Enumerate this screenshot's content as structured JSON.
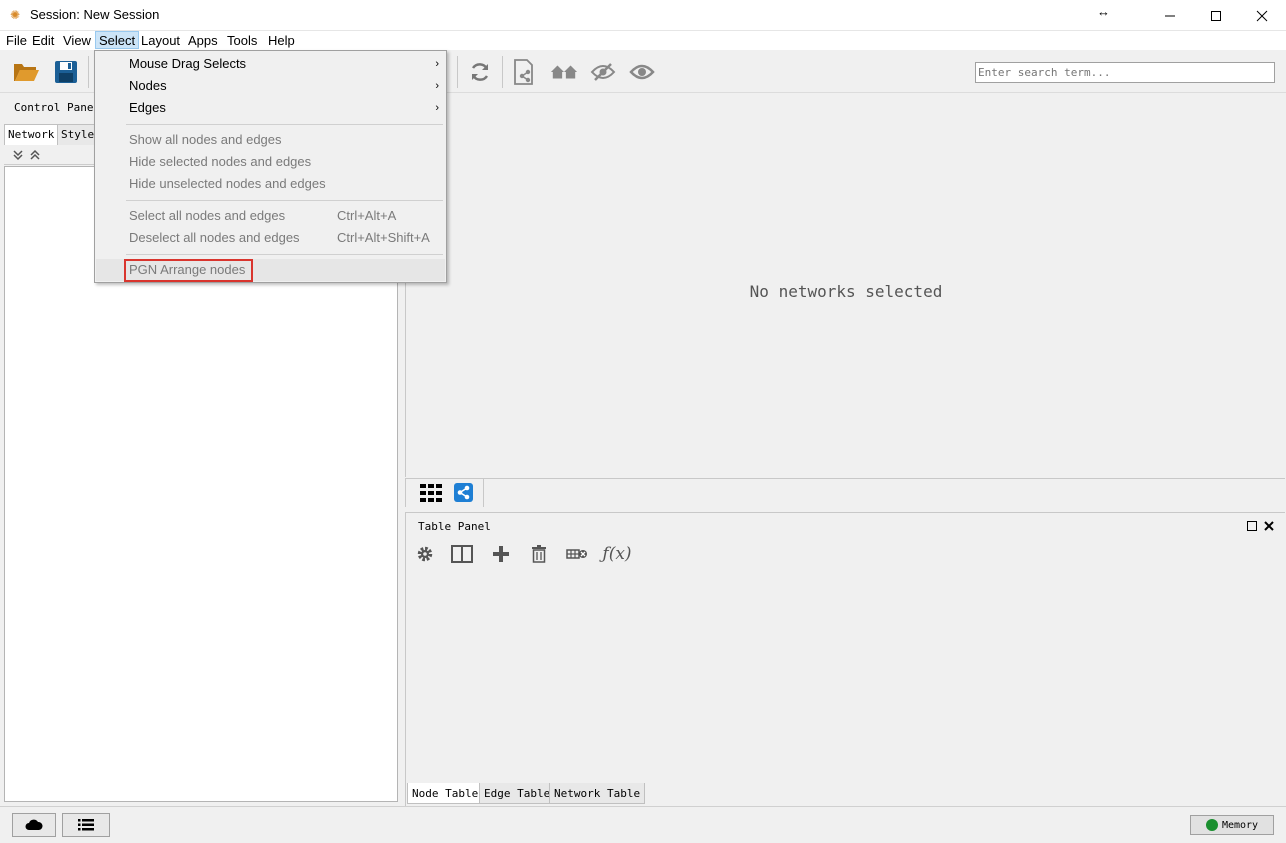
{
  "window": {
    "title": "Session: New Session",
    "resize_glyph": "↔"
  },
  "menubar": {
    "items": [
      "File",
      "Edit",
      "View",
      "Select",
      "Layout",
      "Apps",
      "Tools",
      "Help"
    ]
  },
  "toolbar": {
    "search_placeholder": "Enter search term..."
  },
  "left_panel": {
    "label": "Control Panel",
    "tabs": [
      "Network",
      "Style"
    ]
  },
  "network_view": {
    "empty_message": "No networks selected"
  },
  "table_panel": {
    "title": "Table Panel",
    "tabs": [
      "Node Table",
      "Edge Table",
      "Network Table"
    ]
  },
  "statusbar": {
    "memory_label": "Memory"
  },
  "select_menu": {
    "submenus": [
      "Mouse Drag Selects",
      "Nodes",
      "Edges"
    ],
    "visibility": [
      "Show all nodes and edges",
      "Hide selected nodes and edges",
      "Hide unselected nodes and edges"
    ],
    "select_all": {
      "label": "Select all nodes and edges",
      "shortcut": "Ctrl+Alt+A"
    },
    "deselect_all": {
      "label": "Deselect all nodes and edges",
      "shortcut": "Ctrl+Alt+Shift+A"
    },
    "pgn": "PGN Arrange nodes"
  },
  "colors": {
    "accent": "#1e7fd4",
    "highlight_border": "#d9352e",
    "memory_ok": "#1a8f2f",
    "folder": "#e09a2d",
    "save": "#1b5f96"
  }
}
